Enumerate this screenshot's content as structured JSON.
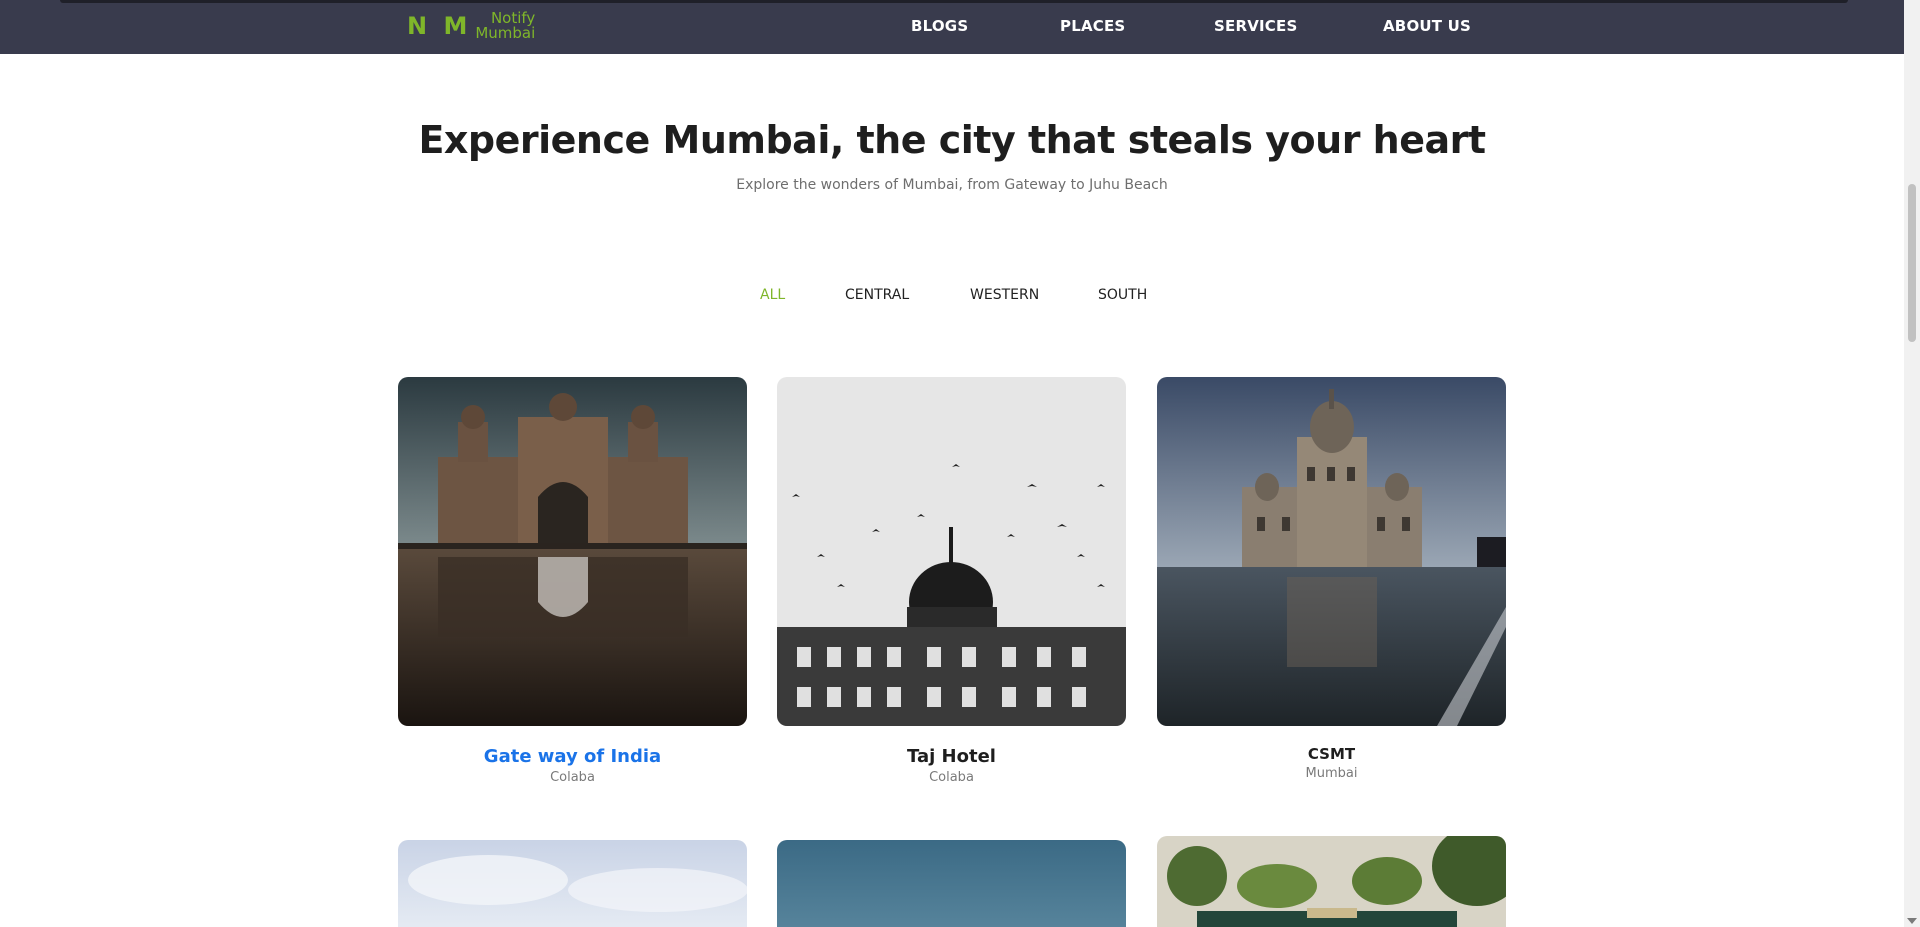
{
  "nav": {
    "logo_mark": "N M",
    "logo_line1": "Notify",
    "logo_line2": "Mumbai",
    "links": [
      "BLOGS",
      "PLACES",
      "SERVICES",
      "ABOUT US"
    ]
  },
  "hero": {
    "title": "Experience Mumbai, the city that steals your heart",
    "subtitle": "Explore the wonders of Mumbai, from Gateway to Juhu Beach"
  },
  "filters": {
    "items": [
      "ALL",
      "CENTRAL",
      "WESTERN",
      "SOUTH"
    ],
    "active": "ALL"
  },
  "places": [
    {
      "name": "Gate way of India",
      "location": "Colaba"
    },
    {
      "name": "Taj Hotel",
      "location": "Colaba"
    },
    {
      "name": "CSMT",
      "location": "Mumbai"
    }
  ],
  "colors": {
    "nav_bg": "#393b4d",
    "brand_green": "#7fb62a",
    "link_blue": "#1a73e8"
  }
}
